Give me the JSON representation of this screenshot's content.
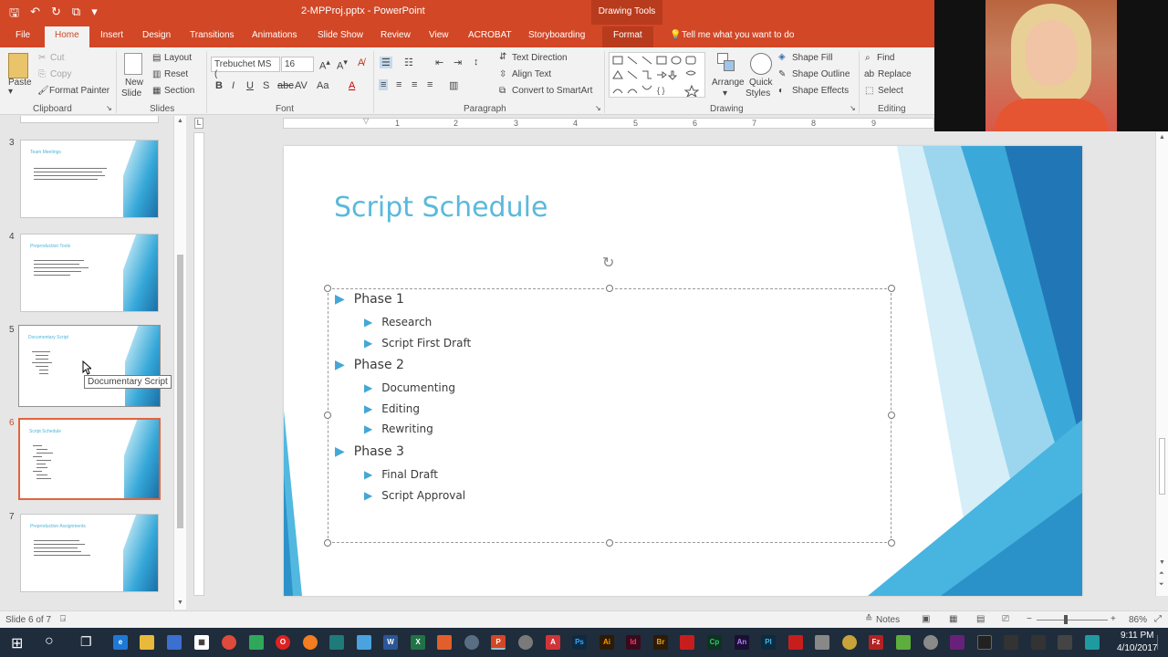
{
  "titlebar": {
    "title": "2-MPProj.pptx  -  PowerPoint",
    "drawing_tools": "Drawing Tools"
  },
  "tabs": [
    "File",
    "Home",
    "Insert",
    "Design",
    "Transitions",
    "Animations",
    "Slide Show",
    "Review",
    "View",
    "ACROBAT",
    "Storyboarding",
    "Format"
  ],
  "tell_me": "Tell me what you want to do",
  "ribbon": {
    "clipboard": {
      "paste": "Paste",
      "cut": "Cut",
      "copy": "Copy",
      "format_painter": "Format Painter",
      "label": "Clipboard"
    },
    "slides": {
      "new_slide_1": "New",
      "new_slide_2": "Slide",
      "layout": "Layout",
      "reset": "Reset",
      "section": "Section",
      "label": "Slides"
    },
    "font": {
      "family": "Trebuchet MS (",
      "size": "16",
      "label": "Font"
    },
    "paragraph": {
      "text_direction": "Text Direction",
      "align_text": "Align Text",
      "convert_smartart": "Convert to SmartArt",
      "label": "Paragraph"
    },
    "drawing": {
      "arrange": "Arrange",
      "quick_styles_1": "Quick",
      "quick_styles_2": "Styles",
      "shape_fill": "Shape Fill",
      "shape_outline": "Shape Outline",
      "shape_effects": "Shape Effects",
      "label": "Drawing"
    },
    "editing": {
      "find": "Find",
      "replace": "Replace",
      "select": "Select",
      "label": "Editing"
    }
  },
  "thumbnails": [
    {
      "num": "3",
      "title": "Team Meetings"
    },
    {
      "num": "4",
      "title": "Preproduction Tools"
    },
    {
      "num": "5",
      "title": "Documentary Script"
    },
    {
      "num": "6",
      "title": "Script Schedule"
    },
    {
      "num": "7",
      "title": "Preproduction Assignments"
    }
  ],
  "tooltip": "Documentary Script",
  "ruler_ticks": [
    "1",
    "2",
    "3",
    "4",
    "5",
    "6",
    "7",
    "8",
    "9"
  ],
  "slide": {
    "title": "Script Schedule",
    "bullets": [
      {
        "level": 1,
        "text": "Phase 1"
      },
      {
        "level": 2,
        "text": "Research"
      },
      {
        "level": 2,
        "text": "Script First Draft"
      },
      {
        "level": 1,
        "text": "Phase 2"
      },
      {
        "level": 2,
        "text": "Documenting"
      },
      {
        "level": 2,
        "text": "Editing"
      },
      {
        "level": 2,
        "text": "Rewriting"
      },
      {
        "level": 1,
        "text": "Phase 3"
      },
      {
        "level": 2,
        "text": "Final Draft"
      },
      {
        "level": 2,
        "text": "Script Approval"
      }
    ]
  },
  "statusbar": {
    "slide_of": "Slide 6 of 7",
    "notes": "Notes",
    "zoom": "86%"
  },
  "clock": {
    "time": "9:11 PM",
    "date": "4/10/2017"
  },
  "colors": {
    "accent": "#d24726",
    "slide_title": "#5ab9dc",
    "bullet": "#44a7d6"
  }
}
